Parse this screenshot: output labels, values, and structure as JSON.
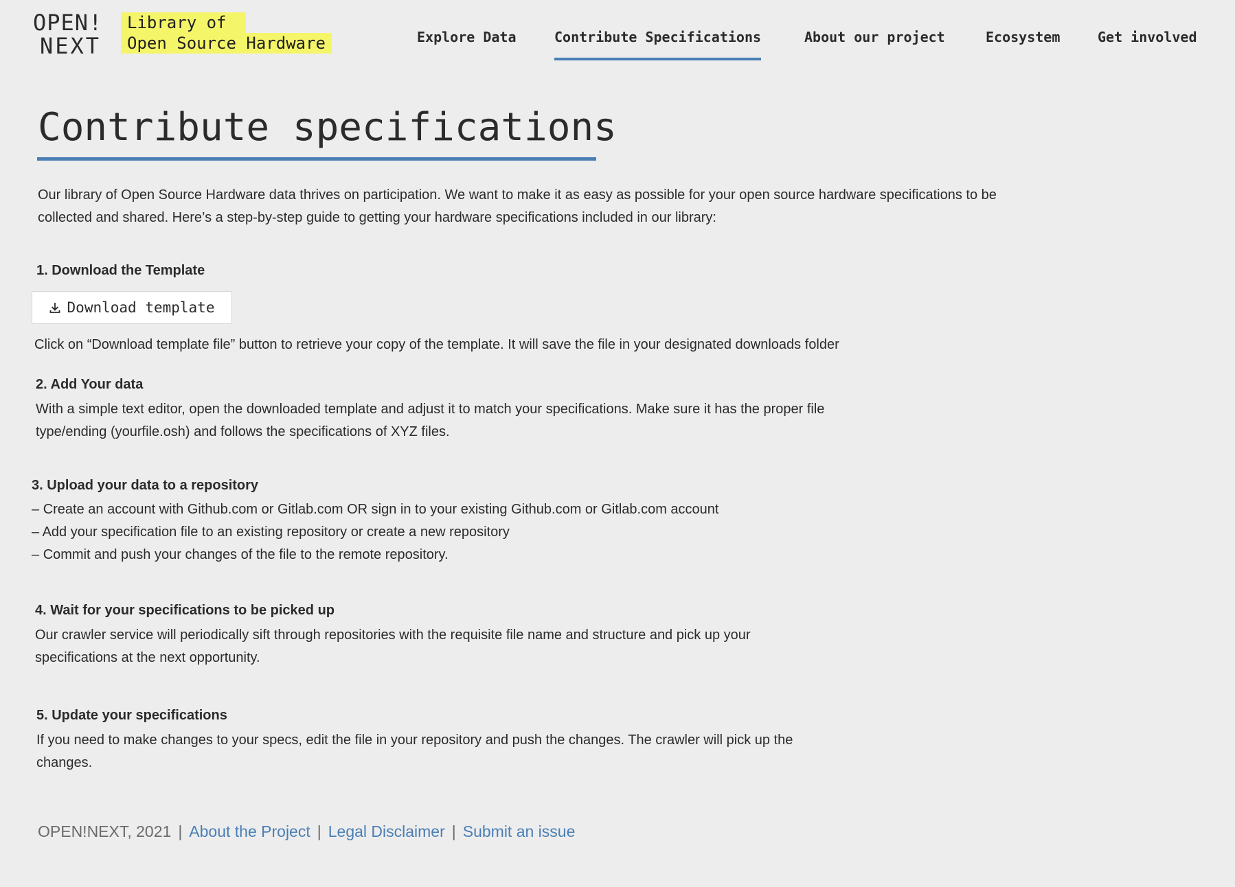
{
  "header": {
    "logo_line1": "OPEN!",
    "logo_line2": "NEXT",
    "tagline_line1": "Library of",
    "tagline_line2": "Open Source Hardware",
    "nav": [
      {
        "label": "Explore Data",
        "active": false
      },
      {
        "label": "Contribute Specifications",
        "active": true
      },
      {
        "label": "About our project",
        "active": false
      },
      {
        "label": "Ecosystem",
        "active": false
      },
      {
        "label": "Get involved",
        "active": false
      }
    ],
    "accent_color": "#4a7fb5",
    "highlight_color": "#f5f56a"
  },
  "main": {
    "title": "Contribute specifications",
    "intro": "Our library of Open Source Hardware data thrives on participation. We want to make it as easy as possible for your open source hardware specifications to be collected and shared. Here’s a step-by-step guide to getting your hardware specifications included in our library:",
    "steps": [
      {
        "heading": "1. Download the Template",
        "button_label": "Download template",
        "button_icon": "download-icon",
        "text": "Click on “Download template file” button to retrieve your copy of the template. It will save the file in your designated downloads folder"
      },
      {
        "heading": "2. Add Your data",
        "text": "With a simple text editor, open the downloaded template and adjust it to match your specifications. Make sure it has the proper file type/ending (yourfile.osh) and follows the specifications of XYZ files."
      },
      {
        "heading": "3. Upload your data to a repository",
        "bullets": [
          "Create an account with Github.com or Gitlab.com OR sign in to your existing Github.com or Gitlab.com account",
          "Add your specification file to an existing repository or create a new repository",
          "Commit and push your changes of the file to the remote repository."
        ]
      },
      {
        "heading": "4. Wait for your specifications to be picked up",
        "text": "Our crawler service will periodically sift through repositories with the requisite file name and structure and pick up your specifications at the next opportunity."
      },
      {
        "heading": "5. Update your specifications",
        "text": "If you need to make changes to your specs, edit the file in your repository and push the changes. The crawler will pick up the changes."
      }
    ]
  },
  "footer": {
    "copyright": "OPEN!NEXT, 2021",
    "separator": "|",
    "links": [
      "About the Project",
      "Legal Disclaimer",
      "Submit an issue"
    ]
  }
}
